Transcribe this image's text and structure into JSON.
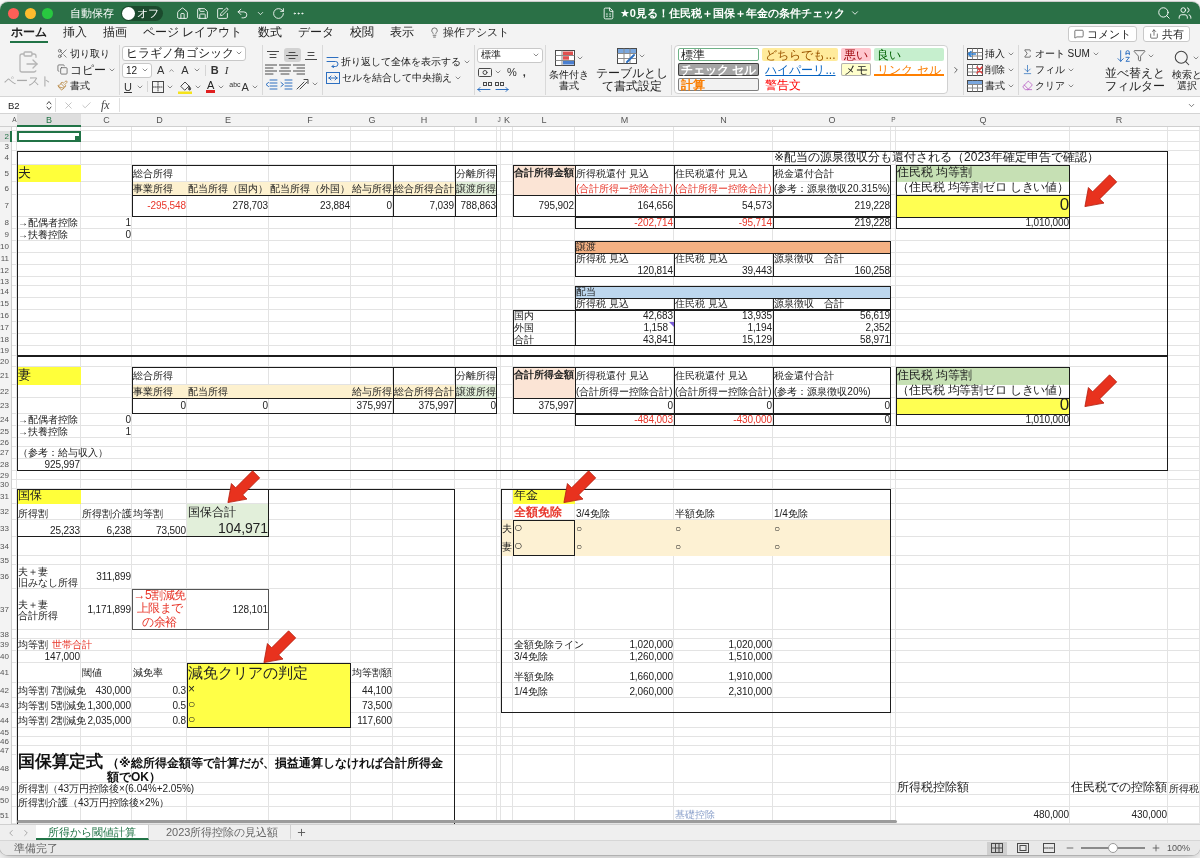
{
  "title_bar": {
    "autosave": {
      "label": "自動保存",
      "state": "オフ",
      "on": false
    },
    "title": "★0見る！住民税＋国保＋年金の条件チェック"
  },
  "ribbon_tabs": [
    {
      "label": "ホーム",
      "selected": true
    },
    {
      "label": "挿入",
      "selected": false
    },
    {
      "label": "描画",
      "selected": false
    },
    {
      "label": "ページ レイアウト",
      "selected": false
    },
    {
      "label": "数式",
      "selected": false
    },
    {
      "label": "データ",
      "selected": false
    },
    {
      "label": "校閲",
      "selected": false
    },
    {
      "label": "表示",
      "selected": false
    }
  ],
  "assist": "操作アシスト",
  "comment_button": "コメント",
  "share_button": "共有",
  "ribbon": {
    "clipboard": {
      "paste": {
        "label": "ペースト",
        "disabled": true
      },
      "cut": "切り取り",
      "copy": "コピー",
      "format_painter": "書式"
    },
    "font": {
      "name": "ヒラギノ角ゴシック",
      "size": "12",
      "grow": "A",
      "shrink": "A",
      "bold": "B",
      "italic": "I",
      "underline": "U",
      "font_color": "A",
      "phonetic": "abc",
      "phonetic_base": "A"
    },
    "vertical_align": [
      {
        "kind": "top",
        "selected": false
      },
      {
        "kind": "middle",
        "selected": true
      },
      {
        "kind": "bottom",
        "selected": false
      }
    ],
    "wrap_text": "折り返して全体を表示する",
    "merge_center": "セルを結合して中央揃え",
    "number": {
      "format": "標準",
      "percent": "%",
      "comma": ","
    },
    "conditional_format": "条件付き書式",
    "format_as_table": "テーブルとして書式設定",
    "styles": [
      {
        "kind": "normal",
        "label": "標準",
        "selected": true
      },
      {
        "kind": "neutral",
        "label": "どちらでも...",
        "selected": false
      },
      {
        "kind": "bad",
        "label": "悪い",
        "selected": false
      },
      {
        "kind": "good",
        "label": "良い",
        "selected": false
      },
      {
        "kind": "check",
        "label": "チェック セル",
        "selected": false
      },
      {
        "kind": "hyperlink",
        "label": "ハイパーリ...",
        "selected": false
      },
      {
        "kind": "note",
        "label": "メモ",
        "selected": false
      },
      {
        "kind": "linked",
        "label": "リンク セル",
        "selected": false
      },
      {
        "kind": "calculation",
        "label": "計算",
        "selected": false
      },
      {
        "kind": "warning",
        "label": "警告文",
        "selected": false
      }
    ],
    "cells": [
      {
        "kind": "insert",
        "label": "挿入"
      },
      {
        "kind": "delete",
        "label": "削除"
      },
      {
        "kind": "format",
        "label": "書式"
      }
    ],
    "editing": {
      "autosum": "オート SUM",
      "fill": "フィル",
      "clear": "クリア",
      "sort_filter": "並べ替えとフィルター",
      "find_select": "検索と選択"
    }
  },
  "formula_bar": {
    "name_box": "B2",
    "fx": "fx"
  },
  "sheet": {
    "column_headers": [
      {
        "label": "A",
        "selected": false
      },
      {
        "label": "B",
        "selected": true
      },
      {
        "label": "C",
        "selected": false
      },
      {
        "label": "D",
        "selected": false
      },
      {
        "label": "E",
        "selected": false
      },
      {
        "label": "F",
        "selected": false
      },
      {
        "label": "G",
        "selected": false
      },
      {
        "label": "H",
        "selected": false
      },
      {
        "label": "I",
        "selected": false
      },
      {
        "label": "J",
        "selected": false
      },
      {
        "label": "K",
        "selected": false
      },
      {
        "label": "L",
        "selected": false
      },
      {
        "label": "M",
        "selected": false
      },
      {
        "label": "N",
        "selected": false
      },
      {
        "label": "O",
        "selected": false
      },
      {
        "label": "P",
        "selected": false
      },
      {
        "label": "Q",
        "selected": false
      },
      {
        "label": "R",
        "selected": false
      }
    ],
    "row_headers": [
      {
        "label": "2",
        "selected": true
      },
      {
        "label": "3",
        "selected": false
      },
      {
        "label": "4",
        "selected": false
      },
      {
        "label": "5",
        "selected": false
      },
      {
        "label": "6",
        "selected": false
      },
      {
        "label": "7",
        "selected": false
      },
      {
        "label": "8",
        "selected": false
      },
      {
        "label": "9",
        "selected": false
      },
      {
        "label": "10",
        "selected": false
      },
      {
        "label": "11",
        "selected": false
      },
      {
        "label": "12",
        "selected": false
      },
      {
        "label": "13",
        "selected": false
      },
      {
        "label": "14",
        "selected": false
      },
      {
        "label": "15",
        "selected": false
      },
      {
        "label": "16",
        "selected": false
      },
      {
        "label": "17",
        "selected": false
      },
      {
        "label": "18",
        "selected": false
      },
      {
        "label": "19",
        "selected": false
      },
      {
        "label": "20",
        "selected": false
      },
      {
        "label": "21",
        "selected": false
      },
      {
        "label": "22",
        "selected": false
      },
      {
        "label": "23",
        "selected": false
      },
      {
        "label": "24",
        "selected": false
      },
      {
        "label": "25",
        "selected": false
      },
      {
        "label": "26",
        "selected": false
      },
      {
        "label": "27",
        "selected": false
      },
      {
        "label": "28",
        "selected": false
      },
      {
        "label": "29",
        "selected": false
      },
      {
        "label": "30",
        "selected": false
      },
      {
        "label": "31",
        "selected": false
      },
      {
        "label": "32",
        "selected": false
      },
      {
        "label": "33",
        "selected": false
      },
      {
        "label": "34",
        "selected": false
      },
      {
        "label": "35",
        "selected": false
      },
      {
        "label": "36",
        "selected": false
      },
      {
        "label": "37",
        "selected": false
      },
      {
        "label": "38",
        "selected": false
      },
      {
        "label": "39",
        "selected": false
      },
      {
        "label": "40",
        "selected": false
      },
      {
        "label": "41",
        "selected": false
      },
      {
        "label": "42",
        "selected": false
      },
      {
        "label": "43",
        "selected": false
      },
      {
        "label": "44",
        "selected": false
      },
      {
        "label": "45",
        "selected": false
      },
      {
        "label": "46",
        "selected": false
      },
      {
        "label": "47",
        "selected": false
      },
      {
        "label": "48",
        "selected": false
      },
      {
        "label": "49",
        "selected": false
      },
      {
        "label": "50",
        "selected": false
      },
      {
        "label": "51",
        "selected": false
      }
    ],
    "spouses": [
      {
        "label": "夫",
        "note": "※配当の源泉徴収分も還付される（2023年確定申告で確認）",
        "income": {
          "title": "総合所得",
          "separate_title": "分離所得",
          "columns": [
            {
              "kind": "income",
              "header": "事業所得",
              "value": "-295,548",
              "negative": true
            },
            {
              "kind": "income",
              "header": "配当所得（国内）",
              "value": "278,703",
              "negative": false
            },
            {
              "kind": "income",
              "header": "配当所得（外国）",
              "value": "23,884",
              "negative": false
            },
            {
              "kind": "income",
              "header": "給与所得",
              "value": "0",
              "negative": false
            },
            {
              "kind": "income",
              "header": "総合所得合計",
              "value": "7,039",
              "negative": false
            },
            {
              "kind": "separate",
              "header": "譲渡所得",
              "value": "788,863",
              "negative": false
            }
          ]
        },
        "deductions": [
          {
            "label": "→配偶者控除",
            "value": "1"
          },
          {
            "label": "→扶養控除",
            "value": "0"
          }
        ],
        "refund": {
          "label": "合計所得金額",
          "amount": "795,902",
          "columns": [
            {
              "title": "所得税還付 見込",
              "note": "(合計所得ー控除合計)",
              "note_emphasis": true,
              "value": "164,656",
              "balance": "-202,714",
              "negative": true
            },
            {
              "title": "住民税還付 見込",
              "note": "(合計所得ー控除合計)",
              "note_emphasis": true,
              "value": "54,573",
              "balance": "-95,714",
              "negative": true
            },
            {
              "title": "税金還付合計",
              "note": "(参考：源泉徴収20.315%)",
              "note_emphasis": false,
              "value": "219,228",
              "balance": "219,228",
              "negative": false
            }
          ]
        },
        "resident_tax": {
          "title": "住民税 均等割",
          "note": "（住民税 均等割ゼロ しきい値）",
          "value": "0",
          "threshold": "1,010,000"
        },
        "transfer": {
          "title": "譲渡",
          "headers": [
            "所得税 見込",
            "住民税 見込",
            "源泉徴収　合計"
          ],
          "values": [
            "120,814",
            "39,443",
            "160,258"
          ]
        },
        "dividend": {
          "title": "配当",
          "headers": [
            "所得税 見込",
            "住民税 見込",
            "源泉徴収　合計"
          ],
          "rows": [
            {
              "label": "国内",
              "values": [
                "42,683",
                "13,935",
                "56,619"
              ],
              "comment": false
            },
            {
              "label": "外国",
              "values": [
                "1,158",
                "1,194",
                "2,352"
              ],
              "comment": true
            },
            {
              "label": "合計",
              "values": [
                "43,841",
                "15,129",
                "58,971"
              ],
              "comment": false
            }
          ]
        }
      },
      {
        "label": "妻",
        "income": {
          "title": "総合所得",
          "separate_title": "分離所得",
          "columns": [
            {
              "kind": "income",
              "header": "事業所得",
              "value": "0",
              "negative": false
            },
            {
              "kind": "income",
              "header": "配当所得",
              "value": "0",
              "negative": false
            },
            {
              "kind": "blank"
            },
            {
              "kind": "income",
              "header": "給与所得",
              "value": "375,997",
              "negative": false
            },
            {
              "kind": "income",
              "header": "総合所得合計",
              "value": "375,997",
              "negative": false
            },
            {
              "kind": "separate",
              "header": "譲渡所得",
              "value": "0",
              "negative": false
            }
          ]
        },
        "deductions": [
          {
            "label": "→配偶者控除",
            "value": "0"
          },
          {
            "label": "→扶養控除",
            "value": "1"
          }
        ],
        "reference": {
          "label": "（参考：給与収入）",
          "value": "925,997"
        },
        "refund": {
          "label": "合計所得金額",
          "amount": "375,997",
          "columns": [
            {
              "title": "所得税還付 見込",
              "note": "(合計所得ー控除合計)",
              "note_emphasis": false,
              "value": "0",
              "balance": "-484,003",
              "negative": true
            },
            {
              "title": "住民税還付 見込",
              "note": "(合計所得ー控除合計)",
              "note_emphasis": false,
              "value": "0",
              "balance": "-430,000",
              "negative": true
            },
            {
              "title": "税金還付合計",
              "note": "(参考：源泉徴収20%)",
              "note_emphasis": false,
              "value": "0",
              "balance": "0",
              "negative": false
            }
          ]
        },
        "resident_tax": {
          "title": "住民税 均等割",
          "note": "（住民税 均等割ゼロ しきい値）",
          "value": "0",
          "threshold": "1,010,000"
        }
      }
    ],
    "kokuho": {
      "label": "国保",
      "items": [
        {
          "label": "所得割",
          "value": "25,233"
        },
        {
          "label": "所得割介護",
          "value": "6,238"
        },
        {
          "label": "均等割",
          "value": "73,500"
        }
      ],
      "total": {
        "label": "国保合計",
        "value": "104,971"
      },
      "income_rows": [
        {
          "lines": [
            "夫＋妻",
            "旧みなし所得"
          ],
          "value": "311,899"
        },
        {
          "lines": [
            "夫＋妻",
            "合計所得"
          ],
          "value": "1,171,899"
        }
      ],
      "margin": {
        "label": "→5割減免上限までの余裕",
        "value": "128,101"
      },
      "household": {
        "label": "均等割",
        "emphasis": "世帯合計",
        "value": "147,000"
      },
      "reduction": {
        "threshold_header": "閾値",
        "rate_header": "減免率",
        "title": "減免クリアの判定",
        "amount_header": "均等割額",
        "rows": [
          {
            "label": "均等割 7割減免",
            "threshold": "430,000",
            "rate": "0.3",
            "result": "×",
            "amount": "44,100"
          },
          {
            "label": "均等割 5割減免",
            "threshold": "1,300,000",
            "rate": "0.5",
            "result": "○",
            "amount": "73,500"
          },
          {
            "label": "均等割 2割減免",
            "threshold": "2,035,000",
            "rate": "0.8",
            "result": "○",
            "amount": "117,600"
          }
        ]
      },
      "formula": {
        "title": "国保算定式",
        "note": "（※総所得金額等で計算だが、損益通算しなければ合計所得金額でOK）",
        "lines": [
          "所得割（43万円控除後×(6.04%+2.05%)",
          "所得割介護（43万円控除後×2%）"
        ]
      }
    },
    "pension": {
      "label": "年金",
      "levels": [
        {
          "label": "全額免除",
          "selected": true
        },
        {
          "label": "3/4免除",
          "selected": false
        },
        {
          "label": "半額免除",
          "selected": false
        },
        {
          "label": "1/4免除",
          "selected": false
        }
      ],
      "people": [
        {
          "label": "夫",
          "marks": [
            "○",
            "○",
            "○",
            "○"
          ]
        },
        {
          "label": "妻",
          "marks": [
            "○",
            "○",
            "○",
            "○"
          ]
        }
      ],
      "lines": [
        {
          "label": "全額免除ライン",
          "values": [
            "1,020,000",
            "1,020,000"
          ]
        },
        {
          "label": "3/4免除",
          "values": [
            "1,260,000",
            "1,510,000"
          ]
        },
        {
          "label": "半額免除",
          "values": [
            "1,660,000",
            "1,910,000"
          ]
        },
        {
          "label": "1/4免除",
          "values": [
            "2,060,000",
            "2,310,000"
          ]
        }
      ]
    },
    "deduction_amounts": {
      "headers": [
        "所得税控除額",
        "住民税での控除額",
        "所得税"
      ],
      "label": "基礎控除",
      "values": [
        "480,000",
        "430,000"
      ]
    }
  },
  "sheet_tabs": [
    {
      "label": "所得から閾値計算",
      "selected": true
    },
    {
      "label": "2023所得控除の見込額",
      "selected": false
    }
  ],
  "status_bar": {
    "text": "準備完了",
    "views": [
      {
        "kind": "normal",
        "selected": true
      },
      {
        "kind": "page_layout",
        "selected": false
      },
      {
        "kind": "page_break",
        "selected": false
      }
    ],
    "zoom": {
      "level": 0.5,
      "label": "100%"
    }
  }
}
